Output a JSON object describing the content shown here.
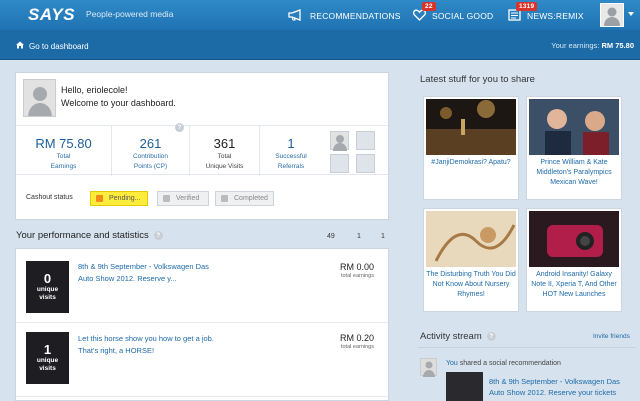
{
  "header": {
    "logo": "SAYS",
    "tagline": "People-powered media",
    "nav": [
      {
        "label": "RECOMMENDATIONS",
        "badge": ""
      },
      {
        "label": "SOCIAL GOOD",
        "badge": "22"
      },
      {
        "label": "NEWS:REMIX",
        "badge": "1319"
      }
    ]
  },
  "subbar": {
    "dashboard_link": "Go to dashboard",
    "earnings_label": "Your earnings:",
    "earnings_value": "RM 75.80"
  },
  "welcome": {
    "greeting": "Hello, eriolecole!",
    "message": "Welcome to your dashboard.",
    "stats": [
      {
        "value": "RM 75.80",
        "label_line1": "Total",
        "label_line2": "Earnings"
      },
      {
        "value": "261",
        "label_line1": "Contribution",
        "label_line2": "Points (CP)"
      },
      {
        "value": "361",
        "label_line1": "Total",
        "label_line2": "Unique Visits"
      },
      {
        "value": "1",
        "label_line1": "Successful",
        "label_line2": "Referrals"
      }
    ],
    "help_glyph": "?",
    "cashout_label": "Cashout status",
    "cashout_steps": [
      "Pending...",
      "Verified",
      "Completed"
    ]
  },
  "performance": {
    "title": "Your performance and statistics",
    "help_glyph": "?",
    "counts": [
      "49",
      "1",
      "1"
    ],
    "rows": [
      {
        "thumb_value": "0",
        "thumb_line1": "unique",
        "thumb_line2": "visits",
        "link_line1": "8th & 9th September - Volkswagen Das",
        "link_line2": "Auto Show 2012. Reserve y...",
        "amount": "RM 0.00",
        "amount_label": "total earnings"
      },
      {
        "thumb_value": "1",
        "thumb_line1": "unique",
        "thumb_line2": "visits",
        "link_line1": "Let this horse show you how to get a job.",
        "link_line2": "That's right, a HORSE!",
        "amount": "RM 0.20",
        "amount_label": "total earnings"
      }
    ]
  },
  "share": {
    "title": "Latest stuff for you to share",
    "items": [
      {
        "caption": "#JanjiDemokrasi? Apatu?"
      },
      {
        "caption": "Prince William & Kate Middleton's Paralympics Mexican Wave!"
      },
      {
        "caption": "The Disturbing Truth You Did Not Know About Nursery Rhymes!"
      },
      {
        "caption": "Android Insanity! Galaxy Note II, Xperia T, And Other HOT New Launches"
      }
    ]
  },
  "activity": {
    "title": "Activity stream",
    "help_glyph": "?",
    "invite": "Invite friends",
    "actor": "You",
    "action": " shared a social recommendation",
    "link_line1": "8th & 9th September - Volkswagen Das",
    "link_line2": "Auto Show 2012. Reserve your tickets"
  },
  "colors": {
    "topbar": "#2580c0",
    "subbar": "#1c6aa6",
    "link": "#1d6aa9",
    "pending": "#ffec3d",
    "badge": "#d9342b"
  }
}
